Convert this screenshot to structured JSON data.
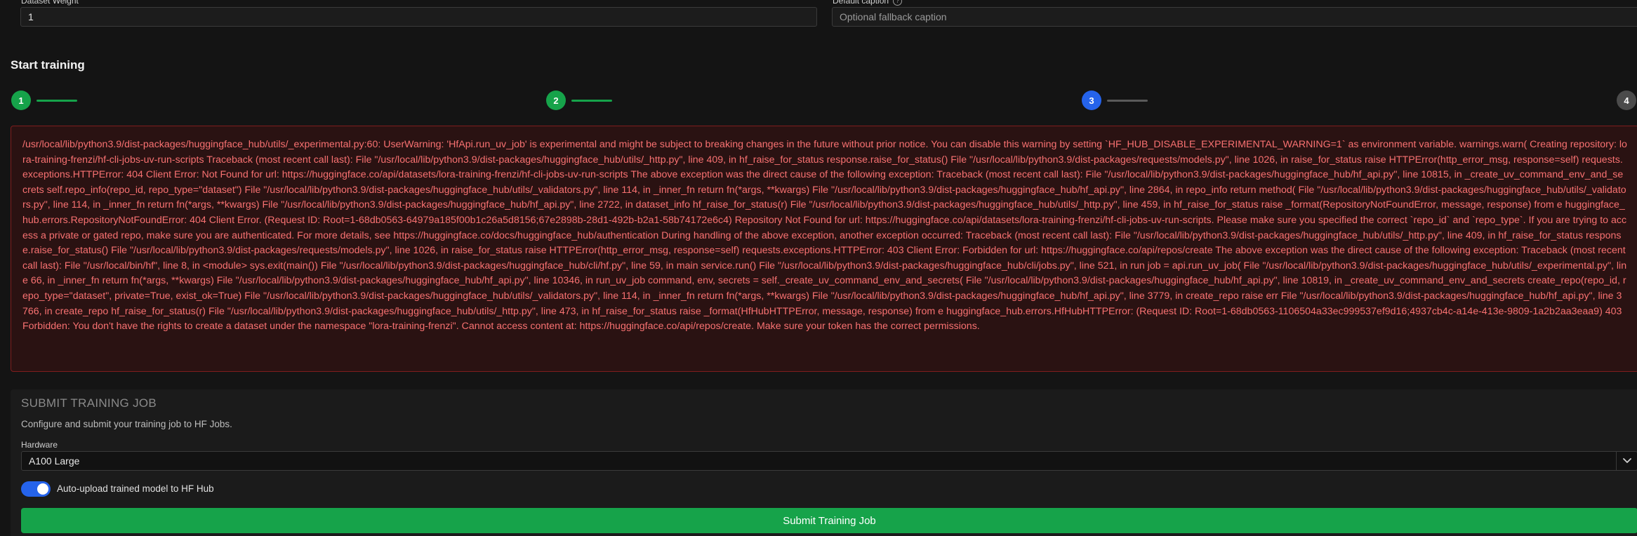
{
  "dataset": {
    "weight_label": "Dataset Weight",
    "weight_value": "1",
    "caption_label": "Default caption",
    "caption_placeholder": "Optional fallback caption",
    "help_glyph": "?"
  },
  "training": {
    "title": "Start training",
    "steps": [
      {
        "number": "1",
        "state": "done"
      },
      {
        "number": "2",
        "state": "done"
      },
      {
        "number": "3",
        "state": "active"
      },
      {
        "number": "4",
        "state": "todo"
      }
    ]
  },
  "error": {
    "message": "/usr/local/lib/python3.9/dist-packages/huggingface_hub/utils/_experimental.py:60: UserWarning: 'HfApi.run_uv_job' is experimental and might be subject to breaking changes in the future without prior notice. You can disable this warning by setting `HF_HUB_DISABLE_EXPERIMENTAL_WARNING=1` as environment variable. warnings.warn( Creating repository: lora-training-frenzi/hf-cli-jobs-uv-run-scripts Traceback (most recent call last): File \"/usr/local/lib/python3.9/dist-packages/huggingface_hub/utils/_http.py\", line 409, in hf_raise_for_status response.raise_for_status() File \"/usr/local/lib/python3.9/dist-packages/requests/models.py\", line 1026, in raise_for_status raise HTTPError(http_error_msg, response=self) requests.exceptions.HTTPError: 404 Client Error: Not Found for url: https://huggingface.co/api/datasets/lora-training-frenzi/hf-cli-jobs-uv-run-scripts The above exception was the direct cause of the following exception: Traceback (most recent call last): File \"/usr/local/lib/python3.9/dist-packages/huggingface_hub/hf_api.py\", line 10815, in _create_uv_command_env_and_secrets self.repo_info(repo_id, repo_type=\"dataset\") File \"/usr/local/lib/python3.9/dist-packages/huggingface_hub/utils/_validators.py\", line 114, in _inner_fn return fn(*args, **kwargs) File \"/usr/local/lib/python3.9/dist-packages/huggingface_hub/hf_api.py\", line 2864, in repo_info return method( File \"/usr/local/lib/python3.9/dist-packages/huggingface_hub/utils/_validators.py\", line 114, in _inner_fn return fn(*args, **kwargs) File \"/usr/local/lib/python3.9/dist-packages/huggingface_hub/hf_api.py\", line 2722, in dataset_info hf_raise_for_status(r) File \"/usr/local/lib/python3.9/dist-packages/huggingface_hub/utils/_http.py\", line 459, in hf_raise_for_status raise _format(RepositoryNotFoundError, message, response) from e huggingface_hub.errors.RepositoryNotFoundError: 404 Client Error. (Request ID: Root=1-68db0563-64979a185f00b1c26a5d8156;67e2898b-28d1-492b-b2a1-58b74172e6c4) Repository Not Found for url: https://huggingface.co/api/datasets/lora-training-frenzi/hf-cli-jobs-uv-run-scripts. Please make sure you specified the correct `repo_id` and `repo_type`. If you are trying to access a private or gated repo, make sure you are authenticated. For more details, see https://huggingface.co/docs/huggingface_hub/authentication During handling of the above exception, another exception occurred: Traceback (most recent call last): File \"/usr/local/lib/python3.9/dist-packages/huggingface_hub/utils/_http.py\", line 409, in hf_raise_for_status response.raise_for_status() File \"/usr/local/lib/python3.9/dist-packages/requests/models.py\", line 1026, in raise_for_status raise HTTPError(http_error_msg, response=self) requests.exceptions.HTTPError: 403 Client Error: Forbidden for url: https://huggingface.co/api/repos/create The above exception was the direct cause of the following exception: Traceback (most recent call last): File \"/usr/local/bin/hf\", line 8, in <module> sys.exit(main()) File \"/usr/local/lib/python3.9/dist-packages/huggingface_hub/cli/hf.py\", line 59, in main service.run() File \"/usr/local/lib/python3.9/dist-packages/huggingface_hub/cli/jobs.py\", line 521, in run job = api.run_uv_job( File \"/usr/local/lib/python3.9/dist-packages/huggingface_hub/utils/_experimental.py\", line 66, in _inner_fn return fn(*args, **kwargs) File \"/usr/local/lib/python3.9/dist-packages/huggingface_hub/hf_api.py\", line 10346, in run_uv_job command, env, secrets = self._create_uv_command_env_and_secrets( File \"/usr/local/lib/python3.9/dist-packages/huggingface_hub/hf_api.py\", line 10819, in _create_uv_command_env_and_secrets create_repo(repo_id, repo_type=\"dataset\", private=True, exist_ok=True) File \"/usr/local/lib/python3.9/dist-packages/huggingface_hub/utils/_validators.py\", line 114, in _inner_fn return fn(*args, **kwargs) File \"/usr/local/lib/python3.9/dist-packages/huggingface_hub/hf_api.py\", line 3779, in create_repo raise err File \"/usr/local/lib/python3.9/dist-packages/huggingface_hub/hf_api.py\", line 3766, in create_repo hf_raise_for_status(r) File \"/usr/local/lib/python3.9/dist-packages/huggingface_hub/utils/_http.py\", line 473, in hf_raise_for_status raise _format(HfHubHTTPError, message, response) from e huggingface_hub.errors.HfHubHTTPError: (Request ID: Root=1-68db0563-1106504a33ec999537ef9d16;4937cb4c-a14e-413e-9809-1a2b2aa3eaa9) 403 Forbidden: You don't have the rights to create a dataset under the namespace \"lora-training-frenzi\". Cannot access content at: https://huggingface.co/api/repos/create. Make sure your token has the correct permissions."
  },
  "submit": {
    "title": "SUBMIT TRAINING JOB",
    "description": "Configure and submit your training job to HF Jobs.",
    "hardware_label": "Hardware",
    "hardware_value": "A100 Large",
    "auto_upload_label": "Auto-upload trained model to HF Hub",
    "auto_upload_enabled": true,
    "button_label": "Submit Training Job"
  },
  "colors": {
    "success": "#16a34a",
    "active": "#2563eb",
    "error_text": "#f87171",
    "error_bg": "#2a1212"
  }
}
